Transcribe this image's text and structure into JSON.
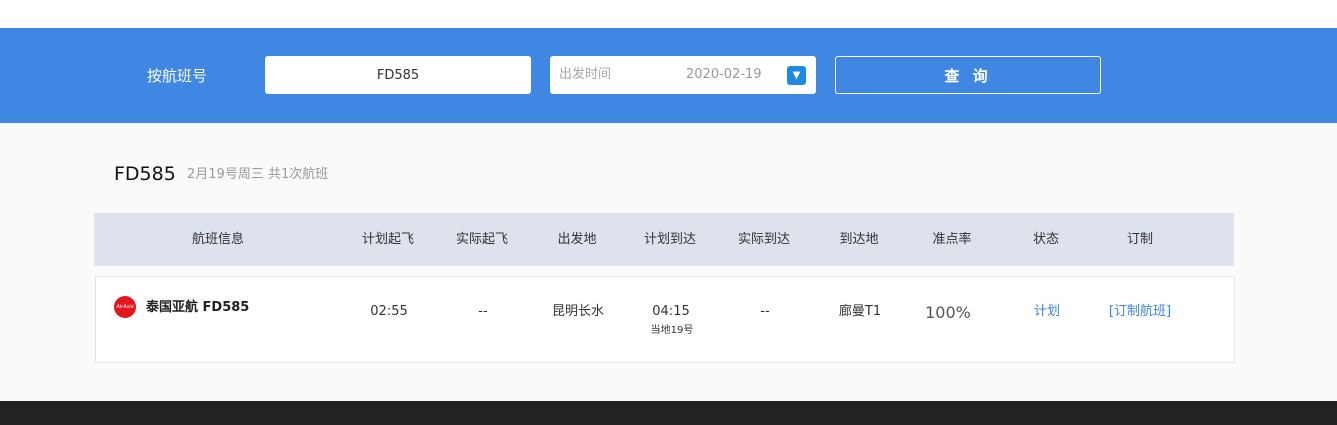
{
  "search": {
    "label": "按航班号",
    "flight_value": "FD585",
    "date_label": "出发时间",
    "date_value": "2020-02-19",
    "dropdown_icon": "chevron-down-icon",
    "button_label": "查 询"
  },
  "result": {
    "flight": "FD585",
    "subtitle": "2月19号周三 共1次航班"
  },
  "table": {
    "headers": [
      "航班信息",
      "计划起飞",
      "实际起飞",
      "出发地",
      "计划到达",
      "实际到达",
      "到达地",
      "准点率",
      "状态",
      "订制"
    ],
    "rows": [
      {
        "logo_text": "AirAsia",
        "airline": "泰国亚航 FD585",
        "planned_departure": "02:55",
        "actual_departure": "--",
        "origin": "昆明长水",
        "planned_arrival": "04:15",
        "arrival_note": "当地19号",
        "actual_arrival": "--",
        "destination": "廊曼T1",
        "on_time_rate": "100%",
        "status": "计划",
        "subscribe": "[订制航班]"
      }
    ]
  },
  "colors": {
    "search_bar": "#3f87e3",
    "table_header": "#dde2ec",
    "link": "#3a86d8",
    "footer": "#222222",
    "logo_red": "#e5151f"
  }
}
